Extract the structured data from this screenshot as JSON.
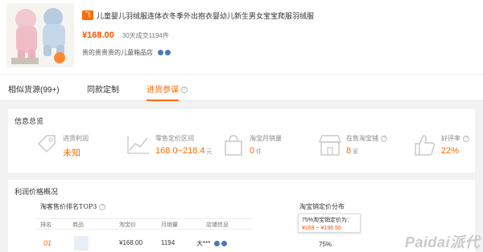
{
  "product": {
    "tag": "飞",
    "title": "儿童婴儿羽绒服连体衣冬季外出抱衣婴幼儿新生男女宝宝爬服羽绒服",
    "price": "¥168.00",
    "sold": "30天成交1194件",
    "shop": "贵的贵贵贵的儿童箱品店",
    "thumb_badge": "¥168"
  },
  "tabs": [
    {
      "label": "相似货源(99+)"
    },
    {
      "label": "同款定制"
    },
    {
      "label": "进货参谋"
    }
  ],
  "overview": {
    "title": "信息总览",
    "metrics": [
      {
        "icon": "tag-icon",
        "label": "进货利润",
        "value": "未知",
        "unit": ""
      },
      {
        "icon": "trend-chart-icon",
        "label": "零售定价区间",
        "value": "168.0~218.4",
        "unit": "元"
      },
      {
        "icon": "shopping-bag-icon",
        "label": "淘宝月销量",
        "value": "0",
        "unit": "件"
      },
      {
        "icon": "store-icon",
        "label": "在售淘宝铺",
        "value": "8",
        "unit": "家"
      },
      {
        "icon": "thumbs-up-icon",
        "label": "好评率",
        "value": "22%",
        "unit": ""
      }
    ]
  },
  "profit": {
    "title": "利润价格概况",
    "top3_title": "淘客售价排名TOP3",
    "dist_title": "淘宝销定价分布",
    "columns": [
      "排名",
      "商品",
      "淘宝价",
      "月销量",
      "店铺信息"
    ],
    "rows": [
      {
        "rank": "01",
        "price": "¥168.00",
        "sales": "1194",
        "shop": "大***"
      }
    ],
    "tooltip_line1": "75%淘宝销定价为：",
    "tooltip_line2": "¥168 ~ ¥196.56",
    "dist_pct": "75%"
  },
  "watermark": "Paidai派代",
  "colors": {
    "accent": "#ff6a00",
    "price": "#ff5000"
  }
}
